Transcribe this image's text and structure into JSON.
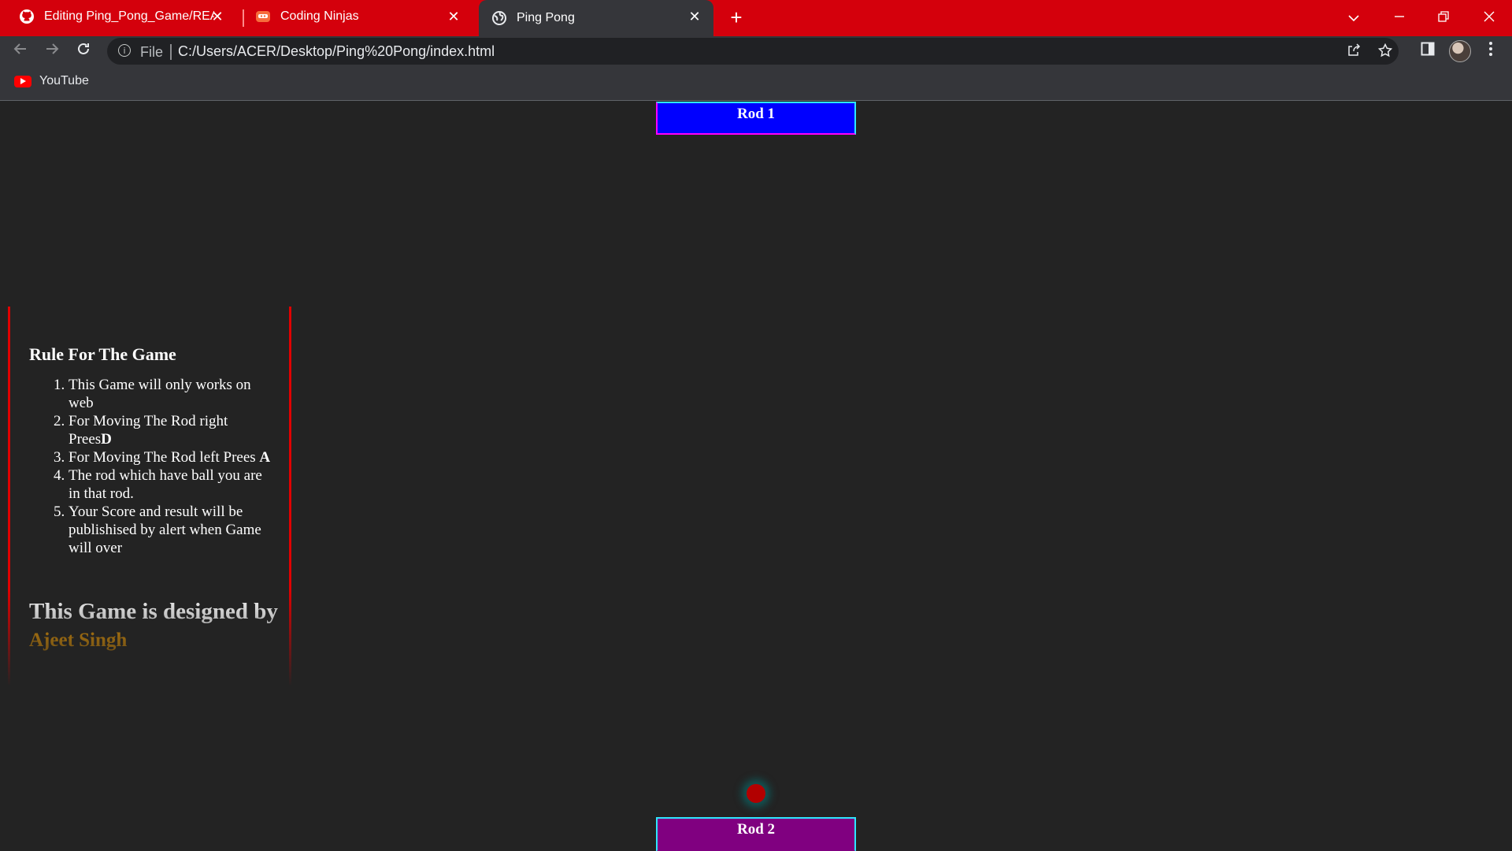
{
  "browser": {
    "tabs": [
      {
        "label": "Editing Ping_Pong_Game/READM",
        "icon": "github-icon",
        "active": false
      },
      {
        "label": "Coding Ninjas",
        "icon": "coding-ninjas-icon",
        "active": false
      },
      {
        "label": "Ping Pong",
        "icon": "globe-icon",
        "active": true
      }
    ],
    "new_tab": "+",
    "address": {
      "scheme_label": "File",
      "url": "C:/Users/ACER/Desktop/Ping%20Pong/index.html"
    },
    "bookmarks": [
      {
        "label": "YouTube",
        "icon": "youtube-icon"
      }
    ],
    "colors": {
      "tabstrip": "#d4000c",
      "toolbar": "#35363a"
    }
  },
  "game": {
    "rod1_label": "Rod 1",
    "rod2_label": "Rod 2",
    "colors": {
      "rod1": "#0000ff",
      "rod2": "#800080",
      "ball": "#b20000",
      "background": "#232323"
    }
  },
  "rules": {
    "title": "Rule For The Game",
    "items": [
      {
        "text": "This Game will only works on web",
        "key": ""
      },
      {
        "text": "For Moving The Rod right Prees",
        "key": "D"
      },
      {
        "text": "For Moving The Rod left Prees ",
        "key": "A"
      },
      {
        "text": "The rod which have ball you are in that rod.",
        "key": ""
      },
      {
        "text": "Your Score and result will be publishised by alert when Game will over",
        "key": ""
      }
    ],
    "credit_prefix": "This Game is designed by ",
    "credit_author": "Ajeet Singh",
    "accent_color": "#ffa500"
  }
}
